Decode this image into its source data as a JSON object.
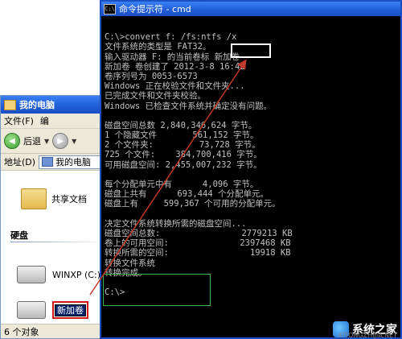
{
  "explorer": {
    "title": "我的电脑",
    "menu": [
      "文件(F)",
      "编"
    ],
    "toolbar": {
      "back_label": "后退"
    },
    "address": {
      "label": "地址(D)",
      "value": "我的电脑"
    },
    "items": {
      "shared_docs": "共享文档",
      "section_disk": "硬盘",
      "drive_c": "WINXP (C:)",
      "drive_f_rename": "新加卷"
    },
    "status": "6 个对象"
  },
  "cmd": {
    "title": "命令提示符 - cmd",
    "lines": [
      "",
      "C:\\>convert f: /fs:ntfs /x",
      "文件系统的类型是 FAT32。",
      "输入驱动器 F: 的当前卷标 新加卷",
      "新加卷 卷创建了 2012-3-8 16:42",
      "卷序列号为 0053-6573",
      "Windows 正在校验文件和文件夹...",
      "已完成文件和文件夹校验。",
      "Windows 已检查文件系统并确定没有问题。",
      "",
      "磁盘空间总数 2,840,346,624 字节。",
      "1 个隐藏文件       561,152 字节。",
      "2 个文件夹:         73,728 字节。",
      "725 个文件:    384,700,416 字节。",
      "可用磁盘空间: 2,455,007,232 字节。",
      "",
      "每个分配单元中有      4,096 字节。",
      "磁盘上共有      693,444 个分配单元。",
      "磁盘上有     599,367 个可用的分配单元。",
      "",
      "决定文件系统转换所需的磁盘空间...",
      "磁盘空间总数:                2779213 KB",
      "卷上的可用空间:              2397468 KB",
      "转换所需的空间:                19918 KB",
      "转换文件系统",
      "转换完成。",
      "",
      "C:\\>"
    ]
  },
  "watermark": {
    "brand": "系统之家",
    "url": "XITONGZHIJIA.NET"
  },
  "colors": {
    "highlight": "#ffffff",
    "arrow": "#c0392b",
    "green_box": "#39b54a",
    "rename_border": "#d01818"
  }
}
